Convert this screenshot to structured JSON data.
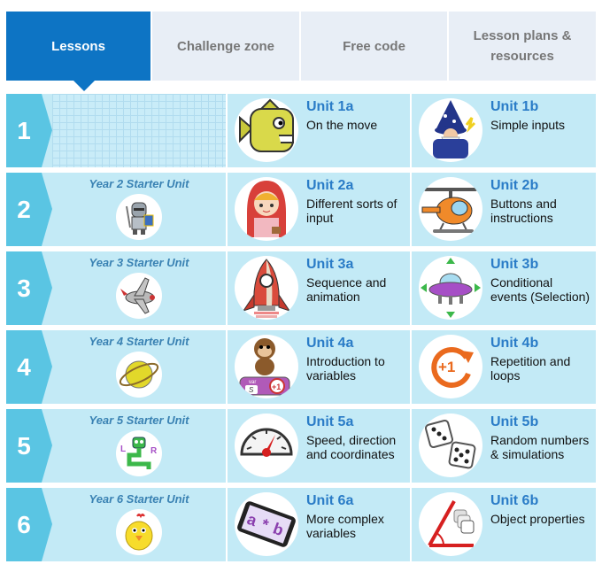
{
  "tabs": [
    {
      "label": "Lessons",
      "active": true
    },
    {
      "label": "Challenge zone",
      "active": false
    },
    {
      "label": "Free code",
      "active": false
    },
    {
      "label": "Lesson plans & resources",
      "active": false
    }
  ],
  "colors": {
    "tab_active": "#0d74c4",
    "row_bg": "#c3eaf6",
    "number_bg": "#5ac5e3",
    "unit_title": "#2a7cc7",
    "starter_title": "#3a82b3"
  },
  "rows": [
    {
      "number": "1",
      "starter": null,
      "unit_a": {
        "title": "Unit 1a",
        "desc": "On the move",
        "icon": "fish-icon"
      },
      "unit_b": {
        "title": "Unit 1b",
        "desc": "Simple inputs",
        "icon": "wizard-icon"
      }
    },
    {
      "number": "2",
      "starter": {
        "title": "Year 2 Starter Unit",
        "icon": "knight-icon"
      },
      "unit_a": {
        "title": "Unit 2a",
        "desc": "Different sorts of input",
        "icon": "red-riding-hood-icon"
      },
      "unit_b": {
        "title": "Unit 2b",
        "desc": "Buttons and instructions",
        "icon": "helicopter-icon"
      }
    },
    {
      "number": "3",
      "starter": {
        "title": "Year 3 Starter Unit",
        "icon": "plane-icon"
      },
      "unit_a": {
        "title": "Unit 3a",
        "desc": "Sequence and animation",
        "icon": "rocket-icon"
      },
      "unit_b": {
        "title": "Unit 3b",
        "desc": "Conditional events (Selection)",
        "icon": "ufo-icon"
      }
    },
    {
      "number": "4",
      "starter": {
        "title": "Year 4 Starter Unit",
        "icon": "planet-icon"
      },
      "unit_a": {
        "title": "Unit 4a",
        "desc": "Introduction to variables",
        "icon": "monkey-variable-icon",
        "var_label": "var",
        "var_name": "S",
        "var_change": "+1"
      },
      "unit_b": {
        "title": "Unit 4b",
        "desc": "Repetition and loops",
        "icon": "loop-plus-one-icon",
        "loop_label": "+1"
      }
    },
    {
      "number": "5",
      "starter": {
        "title": "Year 5 Starter Unit",
        "icon": "snake-letters-icon",
        "letters": [
          "L",
          "R"
        ]
      },
      "unit_a": {
        "title": "Unit 5a",
        "desc": "Speed, direction and coordinates",
        "icon": "speedometer-icon"
      },
      "unit_b": {
        "title": "Unit 5b",
        "desc": "Random numbers & simulations",
        "icon": "dice-icon"
      }
    },
    {
      "number": "6",
      "starter": {
        "title": "Year 6 Starter Unit",
        "icon": "chick-icon"
      },
      "unit_a": {
        "title": "Unit 6a",
        "desc": "More complex variables",
        "icon": "tablet-variables-icon",
        "expr": [
          "a",
          "*",
          "b"
        ]
      },
      "unit_b": {
        "title": "Unit 6b",
        "desc": "Object properties",
        "icon": "object-properties-icon"
      }
    }
  ]
}
